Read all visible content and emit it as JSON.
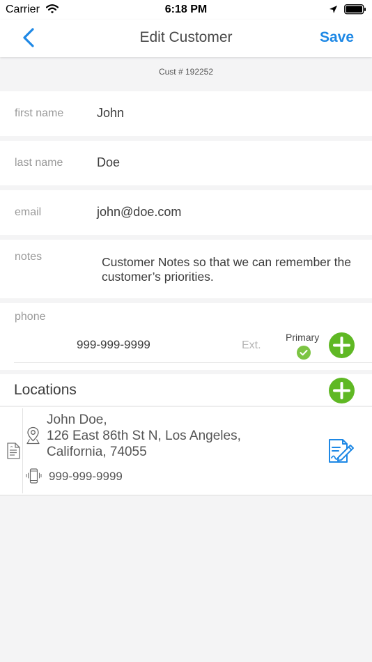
{
  "status_bar": {
    "carrier": "Carrier",
    "time": "6:18 PM"
  },
  "nav": {
    "title": "Edit Customer",
    "save_label": "Save"
  },
  "customer": {
    "number": "Cust # 192252"
  },
  "fields": {
    "first_name": {
      "label": "first name",
      "value": "John"
    },
    "last_name": {
      "label": "last name",
      "value": "Doe"
    },
    "email": {
      "label": "email",
      "value": "john@doe.com"
    },
    "notes": {
      "label": "notes",
      "value": "Customer Notes so that we can remember the customer’s priorities."
    },
    "phone": {
      "label": "phone",
      "value": "999-999-9999",
      "ext_placeholder": "Ext.",
      "primary_label": "Primary"
    }
  },
  "locations": {
    "title": "Locations",
    "items": [
      {
        "address_lines": [
          "John Doe,",
          "126 East 86th St N, Los Angeles,",
          "California, 74055"
        ],
        "phone": "999-999-9999"
      }
    ]
  },
  "colors": {
    "accent_blue": "#1e88e5",
    "add_green": "#5fb824",
    "check_green": "#7cc443"
  }
}
